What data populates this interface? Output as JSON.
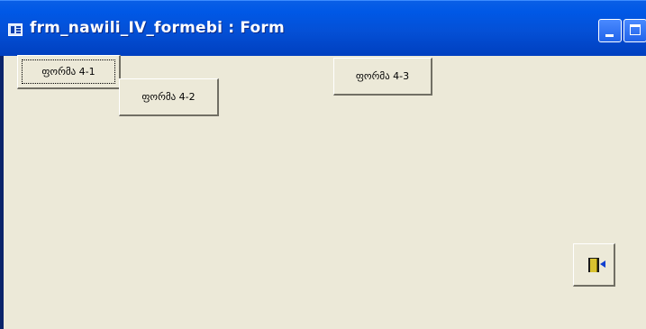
{
  "window": {
    "title": "frm_nawili_IV_formebi : Form"
  },
  "buttons": [
    {
      "label": "ფორმა 4-1"
    },
    {
      "label": "ფორმა 4-2"
    },
    {
      "label": "ფორმა 4-3"
    }
  ],
  "exit_button": {
    "icon": "exit-door-icon"
  },
  "colors": {
    "titlebar": "#0450d6",
    "window_background": "#ece9d8",
    "window_border": "#0a246a"
  }
}
